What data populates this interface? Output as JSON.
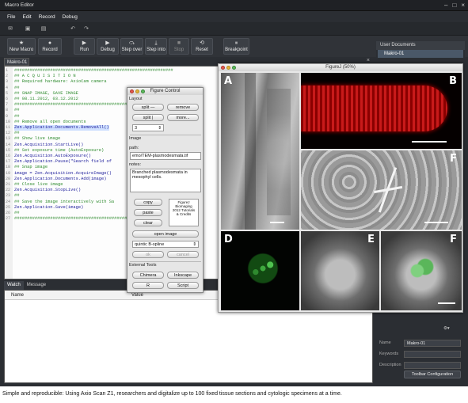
{
  "window": {
    "title": "Macro Editor"
  },
  "menu": [
    "File",
    "Edit",
    "Record",
    "Debug"
  ],
  "toolbar": {
    "new_macro": "New Macro",
    "record": "Record",
    "run": "Run",
    "debug": "Debug",
    "step_over": "Step over",
    "step_into": "Step into",
    "stop": "Stop",
    "reset": "Reset",
    "breakpoint": "Breakpoint"
  },
  "editor": {
    "tab": "Makro-01",
    "lines": [
      {
        "n": "1",
        "text": "##############################################################",
        "cls": "c-green"
      },
      {
        "n": "2",
        "text": "## A C Q U I S I T I O N",
        "cls": "c-green"
      },
      {
        "n": "3",
        "text": "## Required hardware: AxioCam camera",
        "cls": "c-green"
      },
      {
        "n": "4",
        "text": "##",
        "cls": "c-green"
      },
      {
        "n": "5",
        "text": "## SNAP IMAGE, SAVE IMAGE",
        "cls": "c-green"
      },
      {
        "n": "6",
        "text": "## 08.11.2012, 03.12.2012",
        "cls": "c-green"
      },
      {
        "n": "7",
        "text": "##############################################################",
        "cls": "c-green"
      },
      {
        "n": "8",
        "text": "##",
        "cls": "c-green"
      },
      {
        "n": "9",
        "text": "##",
        "cls": "c-green"
      },
      {
        "n": "10",
        "text": "## Remove all open documents",
        "cls": "c-green"
      },
      {
        "n": "11",
        "text": "Zen.Application.Documents.RemoveAll()",
        "cls": "c-blue c-hl"
      },
      {
        "n": "12",
        "text": "##",
        "cls": "c-green"
      },
      {
        "n": "13",
        "text": "## Show live image",
        "cls": "c-green"
      },
      {
        "n": "14",
        "text": "Zen.Acquisition.StartLive()",
        "cls": "c-blue"
      },
      {
        "n": "15",
        "text": "## Set exposure time (AutoExposure)",
        "cls": "c-green"
      },
      {
        "n": "16",
        "text": "Zen.Acquisition.AutoExposure()",
        "cls": "c-blue"
      },
      {
        "n": "17",
        "text": "Zen.Application.Pause(\"Search field of",
        "cls": "c-blue"
      },
      {
        "n": "18",
        "text": "## Snap image",
        "cls": "c-green"
      },
      {
        "n": "19",
        "text": "image = Zen.Acquisition.AcquireImage()",
        "cls": "c-blue"
      },
      {
        "n": "20",
        "text": "Zen.Application.Documents.Add(image)",
        "cls": "c-blue"
      },
      {
        "n": "21",
        "text": "## Close live image",
        "cls": "c-green"
      },
      {
        "n": "22",
        "text": "Zen.Acquisition.StopLive()",
        "cls": "c-blue"
      },
      {
        "n": "23",
        "text": "##",
        "cls": "c-green"
      },
      {
        "n": "24",
        "text": "## Save the image interactively with Sa",
        "cls": "c-green"
      },
      {
        "n": "25",
        "text": "Zen.Application.Save(image)",
        "cls": "c-blue"
      },
      {
        "n": "26",
        "text": "##",
        "cls": "c-green"
      },
      {
        "n": "27",
        "text": "##############################################################",
        "cls": "c-green"
      }
    ]
  },
  "watch": {
    "tabs": [
      "Watch",
      "Message"
    ],
    "columns": [
      "Name",
      "Value"
    ]
  },
  "right_panel": {
    "header": "User Documents",
    "item": "Makro-01",
    "props": {
      "name_label": "Name",
      "name_value": "Makro-01",
      "keywords_label": "Keywords",
      "description_label": "Description",
      "toolbar_config": "Toolbar Configuration"
    }
  },
  "figurej": {
    "title": "FigureJ (50%)",
    "labels": [
      "A",
      "B",
      "F",
      "D",
      "E",
      "F"
    ]
  },
  "figure_control": {
    "title": "Figure Control",
    "layout_label": "Layout",
    "split_h": "split —",
    "remove": "remove",
    "split_v": "split |",
    "more": "more...",
    "count": "3",
    "image_label": "Image",
    "path_label": "path:",
    "path_value": "emo/TEM-plasmodesmata.tif",
    "notes_label": "notes:",
    "notes_value": "Branched plasmodesmata in mesophyl cells.",
    "copy": "copy",
    "paste": "paste",
    "clear": "clear",
    "credits": "FigureJ Biomaging 2012 Tutorials & Credits",
    "open_image": "open image",
    "interp": "quintic B-spline",
    "ok": "ok",
    "cancel": "cancel",
    "external_label": "External Tools",
    "chimera": "Chimera",
    "inkscape": "Inkscape",
    "r": "R",
    "script": "Script"
  },
  "caption": "Simple and reproducible: Using Axio Scan Z1, researchers and digitalize up to 100 fixed tissue sections and cytologic specimens at a time."
}
